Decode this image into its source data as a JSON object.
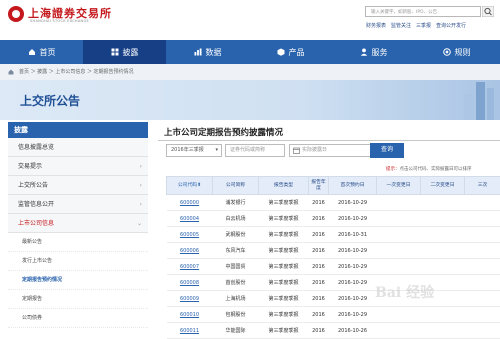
{
  "header": {
    "brand": "上海證券交易所",
    "brand_en": "SHANGHAI STOCK EXCHANGE",
    "search_placeholder": "输入关键字，如新股、IPO、公告",
    "links": [
      "财务报表",
      "监管关注",
      "三季报",
      "查询公开发行"
    ]
  },
  "nav": [
    {
      "label": "首页",
      "icon": "home-icon",
      "active": false
    },
    {
      "label": "披露",
      "icon": "grid-icon",
      "active": true
    },
    {
      "label": "数据",
      "icon": "chart-icon",
      "active": false
    },
    {
      "label": "产品",
      "icon": "cube-icon",
      "active": false
    },
    {
      "label": "服务",
      "icon": "person-icon",
      "active": false
    },
    {
      "label": "规则",
      "icon": "rules-icon",
      "active": false
    }
  ],
  "breadcrumb": "首页 ＞ 披露 ＞ 上市公司信息 ＞ 定期报告预约情况",
  "banner": {
    "title": "上交所公告"
  },
  "sidebar": {
    "heading": "披露",
    "items": [
      "信息披露总览",
      "交易提示",
      "上交所公告",
      "监管信息公开",
      "上市公司信息"
    ],
    "sub_items": [
      "最新公告",
      "发行上市公告",
      "定期报告预约情况",
      "定期报告",
      "公司债券"
    ]
  },
  "main": {
    "title": "上市公司定期报告预约披露情况",
    "period_select": "2016年三季报",
    "code_placeholder": "证券代码或简称",
    "date_placeholder": "实际披露日",
    "query_label": "查询",
    "hint_prefix": "提示：",
    "hint_text": "点击公司代码、实际披露日可以排序",
    "columns": [
      "公司代码",
      "公司简称",
      "报告类型",
      "报告年度",
      "首次预约日",
      "一次变更日",
      "二次变更日",
      "三次"
    ],
    "rows": [
      [
        "600000",
        "浦发银行",
        "第三季度季报",
        "2016",
        "2016-10-29",
        "",
        "",
        ""
      ],
      [
        "600004",
        "白云机场",
        "第三季度季报",
        "2016",
        "2016-10-29",
        "",
        "",
        ""
      ],
      [
        "600005",
        "武钢股份",
        "第三季度季报",
        "2016",
        "2016-10-31",
        "",
        "",
        ""
      ],
      [
        "600006",
        "东风汽车",
        "第三季度季报",
        "2016",
        "2016-10-29",
        "",
        "",
        ""
      ],
      [
        "600007",
        "中国国贸",
        "第三季度季报",
        "2016",
        "2016-10-29",
        "",
        "",
        ""
      ],
      [
        "600008",
        "首创股份",
        "第三季度季报",
        "2016",
        "2016-10-29",
        "",
        "",
        ""
      ],
      [
        "600009",
        "上海机场",
        "第三季度季报",
        "2016",
        "2016-10-29",
        "",
        "",
        ""
      ],
      [
        "600010",
        "包钢股份",
        "第三季度季报",
        "2016",
        "2016-10-29",
        "",
        "",
        ""
      ],
      [
        "600011",
        "华能国际",
        "第三季度季报",
        "2016",
        "2016-10-26",
        "",
        "",
        ""
      ]
    ]
  },
  "watermark": "Bai 经验",
  "colors": {
    "brand_red": "#c4181c",
    "nav_blue": "#2a63ad",
    "nav_active": "#163f86"
  }
}
